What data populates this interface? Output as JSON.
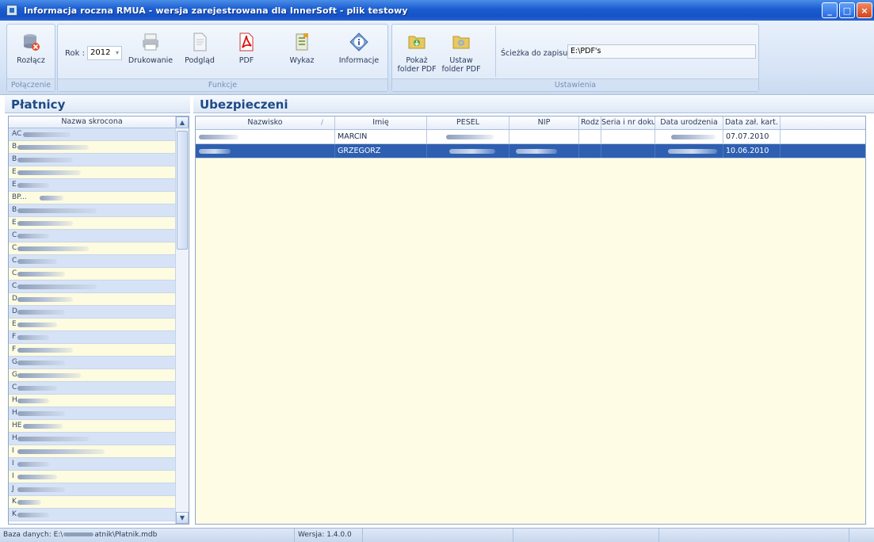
{
  "window": {
    "title": "Informacja roczna RMUA - wersja zarejestrowana dla InnerSoft - plik testowy"
  },
  "ribbon": {
    "groups": {
      "connection": "Połączenie",
      "functions": "Funkcje",
      "settings": "Ustawienia"
    },
    "disconnect_label": "Rozłącz",
    "year_label": "Rok :",
    "year_value": "2012",
    "print_label": "Drukowanie",
    "preview_label": "Podgląd",
    "pdf_label": "PDF",
    "list_label": "Wykaz",
    "info_label": "Informacje",
    "show_folder_label": "Pokaż\nfolder PDF",
    "set_folder_label": "Ustaw\nfolder PDF",
    "pdf_path_label": "Ścieżka do zapisu PDF",
    "pdf_path_value": "E:\\PDF's"
  },
  "left": {
    "header": "Płatnicy",
    "column": "Nazwa skrocona",
    "rows": [
      "AC",
      "B",
      "B",
      "E",
      "E",
      "BP...",
      "B",
      "E",
      "C",
      "C",
      "C",
      "C",
      "C",
      "D",
      "D",
      "E",
      "F",
      "F",
      "G",
      "G",
      "C",
      "H",
      "H",
      "HE",
      "H",
      "I",
      "I",
      "I",
      "J",
      "K",
      "K"
    ]
  },
  "right": {
    "header": "Ubezpieczeni",
    "columns": [
      "Nazwisko",
      "Imię",
      "PESEL",
      "NIP",
      "Rodz",
      "Seria i nr dokum",
      "Data urodzenia",
      "Data zał. kart."
    ],
    "rows": [
      {
        "imie": "MARCIN",
        "data_zal": "07.07.2010"
      },
      {
        "imie": "GRZEGORZ",
        "data_zal": "10.06.2010"
      }
    ]
  },
  "status": {
    "db": "Baza danych: E:\\",
    "db_suffix": "atnik\\Płatnik.mdb",
    "version": "Wersja: 1.4.0.0"
  }
}
